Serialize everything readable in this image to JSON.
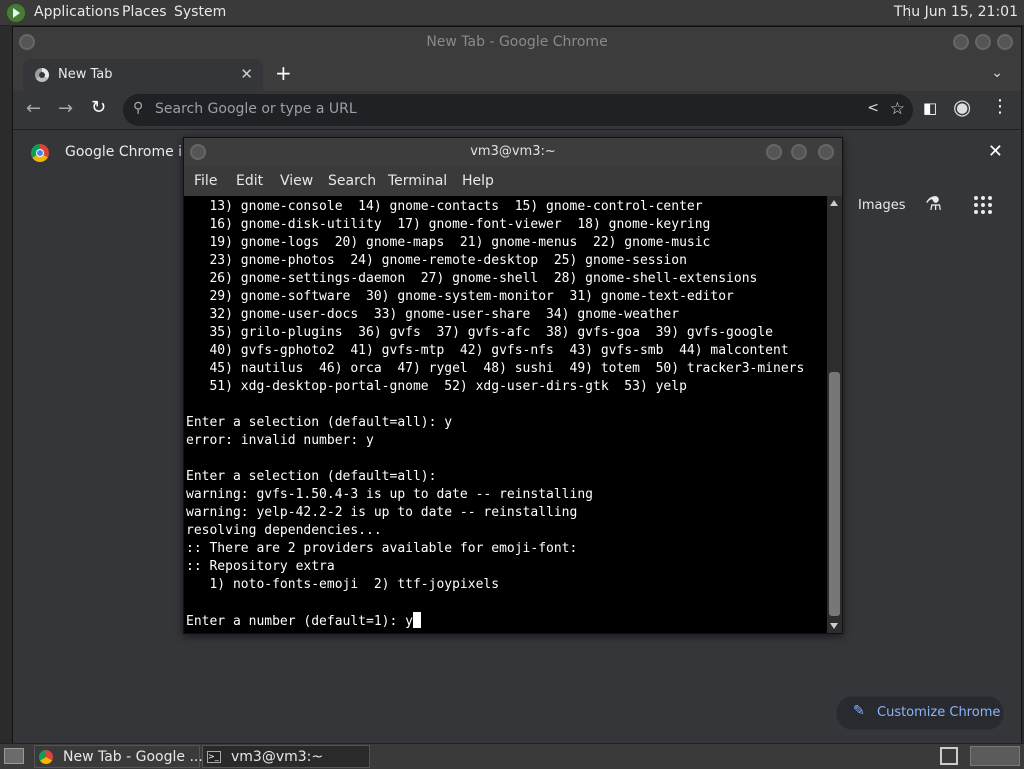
{
  "top_panel": {
    "menus": [
      "Applications",
      "Places",
      "System"
    ],
    "clock": "Thu Jun 15, 21:01"
  },
  "chrome": {
    "window_title": "New Tab - Google Chrome",
    "tab": {
      "title": "New Tab"
    },
    "omnibox": {
      "placeholder": "Search Google or type a URL"
    },
    "infobar": {
      "message": "Google Chrome isn"
    },
    "ntp": {
      "images_link": "Images",
      "customize_label": "Customize Chrome"
    }
  },
  "terminal": {
    "window_title": "vm3@vm3:~",
    "menu": [
      "File",
      "Edit",
      "View",
      "Search",
      "Terminal",
      "Help"
    ],
    "lines": [
      "   13) gnome-console  14) gnome-contacts  15) gnome-control-center",
      "   16) gnome-disk-utility  17) gnome-font-viewer  18) gnome-keyring",
      "   19) gnome-logs  20) gnome-maps  21) gnome-menus  22) gnome-music",
      "   23) gnome-photos  24) gnome-remote-desktop  25) gnome-session",
      "   26) gnome-settings-daemon  27) gnome-shell  28) gnome-shell-extensions",
      "   29) gnome-software  30) gnome-system-monitor  31) gnome-text-editor",
      "   32) gnome-user-docs  33) gnome-user-share  34) gnome-weather",
      "   35) grilo-plugins  36) gvfs  37) gvfs-afc  38) gvfs-goa  39) gvfs-google",
      "   40) gvfs-gphoto2  41) gvfs-mtp  42) gvfs-nfs  43) gvfs-smb  44) malcontent",
      "   45) nautilus  46) orca  47) rygel  48) sushi  49) totem  50) tracker3-miners",
      "   51) xdg-desktop-portal-gnome  52) xdg-user-dirs-gtk  53) yelp",
      "",
      "Enter a selection (default=all): y",
      "error: invalid number: y",
      "",
      "Enter a selection (default=all):",
      "warning: gvfs-1.50.4-3 is up to date -- reinstalling",
      "warning: yelp-42.2-2 is up to date -- reinstalling",
      "resolving dependencies...",
      ":: There are 2 providers available for emoji-font:",
      ":: Repository extra",
      "   1) noto-fonts-emoji  2) ttf-joypixels",
      ""
    ],
    "prompt_line": "Enter a number (default=1): y"
  },
  "taskbar": {
    "tasks": [
      "New Tab - Google ...",
      "vm3@vm3:~"
    ]
  }
}
